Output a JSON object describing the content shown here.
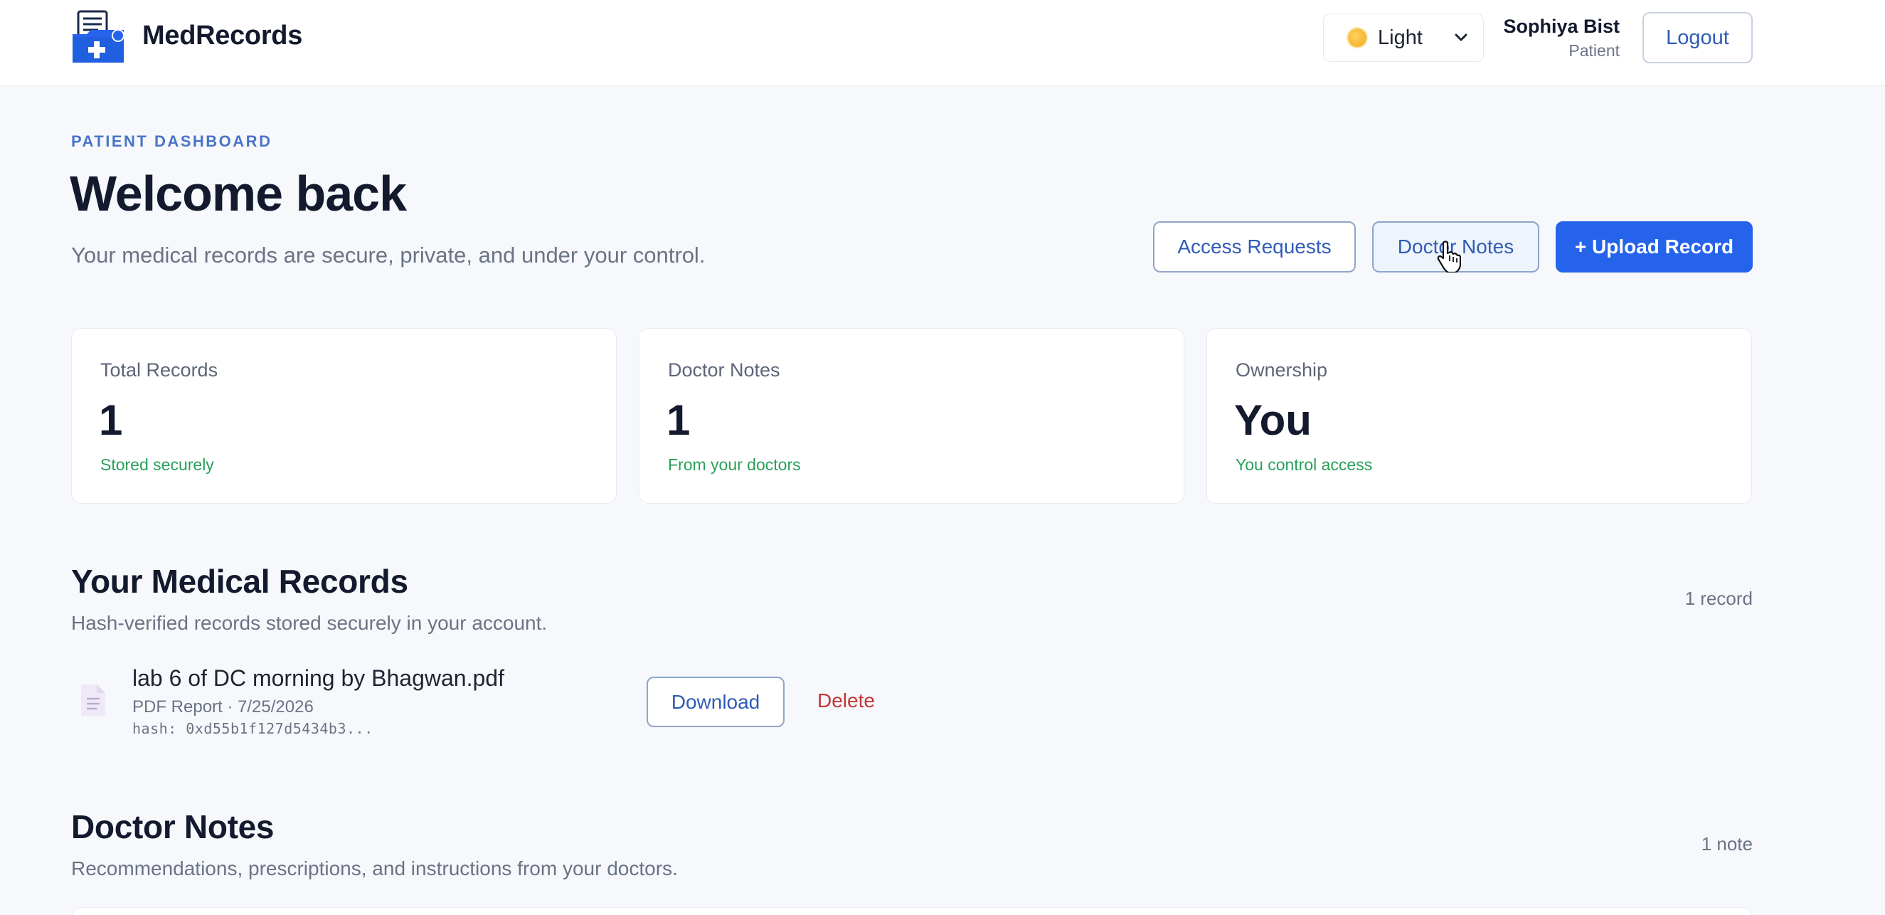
{
  "header": {
    "brand": "MedRecords",
    "theme": {
      "selected": "Light"
    },
    "user": {
      "name": "Sophiya Bist",
      "role": "Patient"
    },
    "logout_label": "Logout"
  },
  "hero": {
    "eyebrow": "PATIENT DASHBOARD",
    "title": "Welcome back",
    "subtitle": "Your medical records are secure, private, and under your control.",
    "actions": {
      "access_requests": "Access Requests",
      "doctor_notes": "Doctor Notes",
      "upload": "+ Upload Record"
    }
  },
  "stats": [
    {
      "label": "Total Records",
      "value": "1",
      "sub": "Stored securely"
    },
    {
      "label": "Doctor Notes",
      "value": "1",
      "sub": "From your doctors"
    },
    {
      "label": "Ownership",
      "value": "You",
      "sub": "You control access"
    }
  ],
  "records": {
    "title": "Your Medical Records",
    "subtitle": "Hash-verified records stored securely in your account.",
    "count": "1 record",
    "items": [
      {
        "name": "lab 6 of DC morning by Bhagwan.pdf",
        "meta": "PDF Report · 7/25/2026",
        "hash": "hash: 0xd55b1f127d5434b3...",
        "download_label": "Download",
        "delete_label": "Delete"
      }
    ]
  },
  "notes": {
    "title": "Doctor Notes",
    "subtitle": "Recommendations, prescriptions, and instructions from your doctors.",
    "count": "1 note"
  },
  "colors": {
    "accent": "#2563eb",
    "link": "#2f5cb7",
    "success": "#28a05a",
    "danger": "#c23636"
  }
}
